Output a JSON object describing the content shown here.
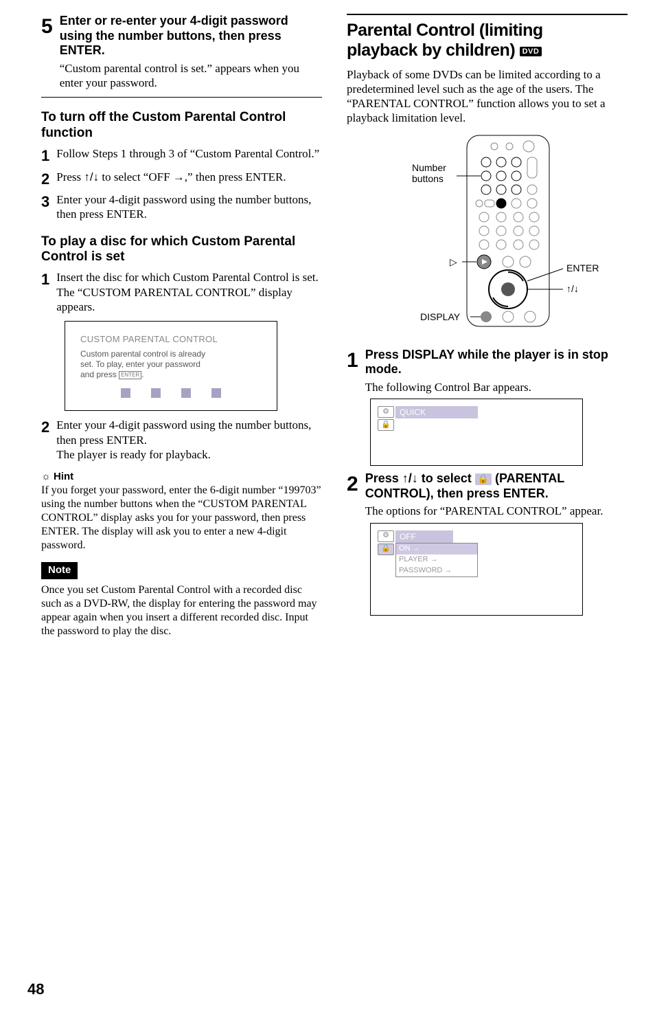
{
  "left": {
    "step5": {
      "num": "5",
      "title": "Enter or re-enter your 4-digit password using the number buttons, then press ENTER.",
      "body": "“Custom parental control is set.” appears when you enter your password."
    },
    "turnoff": {
      "heading": "To turn off the Custom Parental Control function",
      "s1num": "1",
      "s1": "Follow Steps 1 through 3 of “Custom Parental Control.”",
      "s2num": "2",
      "s2a": "Press ",
      "s2arrows": "↑/↓",
      "s2b": " to select “OFF ",
      "s2arrow_r": "→",
      "s2c": ",” then press ENTER.",
      "s3num": "3",
      "s3": "Enter your 4-digit password using the number buttons, then press ENTER."
    },
    "playdisc": {
      "heading": "To play a disc for which Custom Parental Control is set",
      "s1num": "1",
      "s1a": "Insert the disc for which Custom Parental Control is set.",
      "s1b": "The “CUSTOM PARENTAL CONTROL” display appears.",
      "display": {
        "title": "CUSTOM PARENTAL CONTROL",
        "line1": "Custom parental control is already",
        "line2": "set. To play, enter your password",
        "line3a": "and press ",
        "enter_btn": "ENTER",
        "line3b": "."
      },
      "s2num": "2",
      "s2a": "Enter your 4-digit password using the number buttons, then press ENTER.",
      "s2b": "The player is ready for playback."
    },
    "hint": {
      "icon": "☼",
      "label": "Hint",
      "body": "If you forget your password, enter the 6-digit number “199703” using the number buttons when the “CUSTOM PARENTAL CONTROL” display asks you for your password, then press ENTER. The display will ask you to enter a new 4-digit password."
    },
    "note": {
      "label": "Note",
      "body": "Once you set Custom Parental Control with a recorded disc such as a DVD-RW, the display for entering the password may appear again when you insert a different recorded disc. Input the password to play the disc."
    }
  },
  "right": {
    "title_l1": "Parental Control (limiting",
    "title_l2a": "playback by children) ",
    "dvd_badge": "DVD",
    "intro": "Playback of some DVDs can be limited according to a predetermined level such as the age of the users. The “PARENTAL CONTROL” function allows you to set a playback limitation level.",
    "remote": {
      "numberbuttons": "Number buttons",
      "play_glyph": "▷",
      "display": "DISPLAY",
      "enter": "ENTER",
      "arrows": "↑/↓"
    },
    "step1": {
      "num": "1",
      "title": "Press DISPLAY while the player is in stop mode.",
      "body": "The following Control Bar appears.",
      "quick": "QUICK",
      "icon": "🔒"
    },
    "step2": {
      "num": "2",
      "title_a": "Press ",
      "arrows": "↑/↓",
      "title_b": " to select  ",
      "lockicon": "🔒",
      "title_c": "  (PARENTAL CONTROL), then press ENTER.",
      "body": "The options for “PARENTAL CONTROL” appear.",
      "opt_off": "OFF",
      "opt_on": "ON →",
      "opt_player": "PLAYER →",
      "opt_pw": "PASSWORD →"
    }
  },
  "pagenum": "48"
}
